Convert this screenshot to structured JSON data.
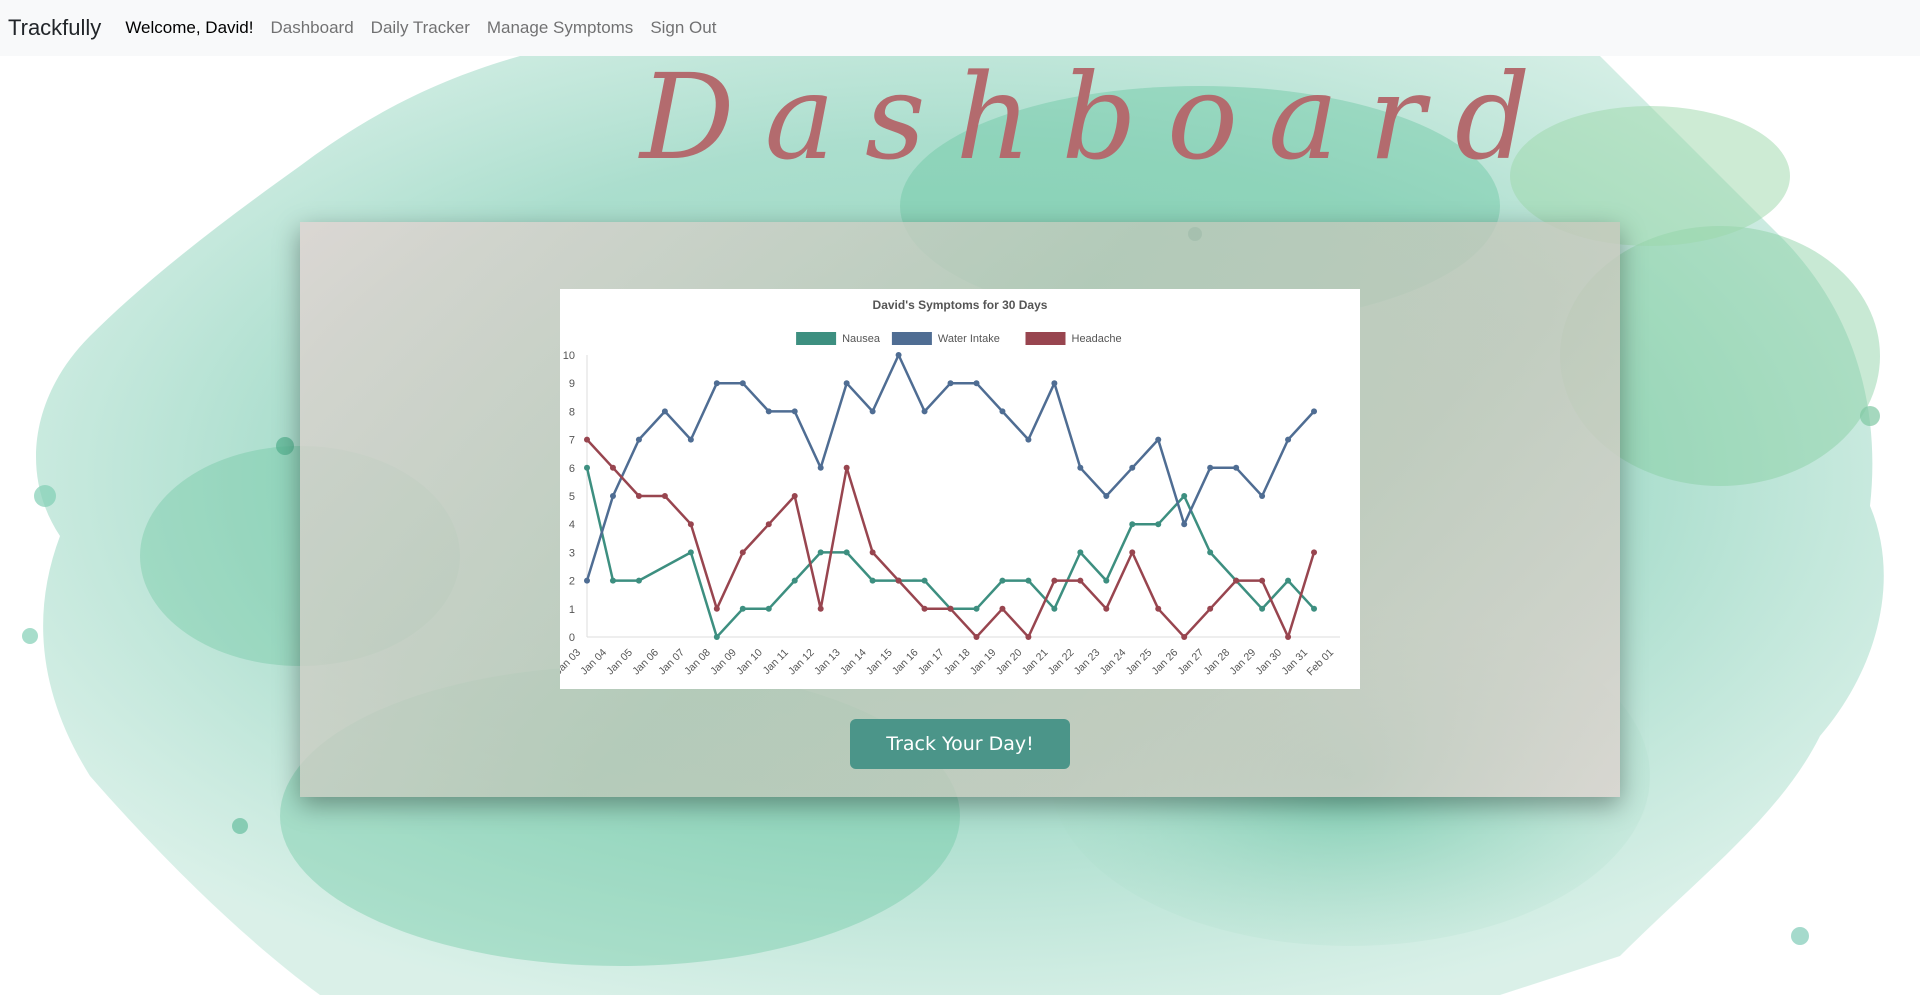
{
  "navbar": {
    "brand": "Trackfully",
    "welcome": "Welcome, David!",
    "links": [
      "Dashboard",
      "Daily Tracker",
      "Manage Symptoms",
      "Sign Out"
    ]
  },
  "page": {
    "title": "Dashboard",
    "button_label": "Track Your Day!"
  },
  "colors": {
    "nausea": "#3d8f80",
    "water": "#4f6d93",
    "headache": "#98454f",
    "title": "#b36b6e",
    "button": "#4b9589"
  },
  "chart_data": {
    "type": "line",
    "title": "David's Symptoms for 30 Days",
    "x": [
      "Jan 03",
      "Jan 04",
      "Jan 05",
      "Jan 06",
      "Jan 07",
      "Jan 08",
      "Jan 09",
      "Jan 10",
      "Jan 11",
      "Jan 12",
      "Jan 13",
      "Jan 14",
      "Jan 15",
      "Jan 16",
      "Jan 17",
      "Jan 18",
      "Jan 19",
      "Jan 20",
      "Jan 21",
      "Jan 22",
      "Jan 23",
      "Jan 24",
      "Jan 25",
      "Jan 26",
      "Jan 27",
      "Jan 28",
      "Jan 29",
      "Jan 30",
      "Jan 31",
      "Feb 01"
    ],
    "ylim": [
      0,
      10
    ],
    "yticks": [
      0,
      1,
      2,
      3,
      4,
      5,
      6,
      7,
      8,
      9,
      10
    ],
    "legend_position": "top",
    "series": [
      {
        "name": "Nausea",
        "color": "#3d8f80",
        "values": [
          6,
          2,
          2,
          null,
          3,
          0,
          1,
          1,
          2,
          3,
          3,
          2,
          2,
          2,
          1,
          1,
          2,
          2,
          1,
          3,
          2,
          4,
          4,
          5,
          3,
          2,
          1,
          2,
          1,
          null
        ]
      },
      {
        "name": "Water Intake",
        "color": "#4f6d93",
        "values": [
          2,
          5,
          7,
          8,
          7,
          9,
          9,
          8,
          8,
          6,
          9,
          8,
          10,
          8,
          9,
          9,
          8,
          7,
          9,
          6,
          5,
          6,
          7,
          4,
          6,
          6,
          5,
          7,
          8,
          null
        ]
      },
      {
        "name": "Headache",
        "color": "#98454f",
        "values": [
          7,
          6,
          5,
          5,
          4,
          1,
          3,
          4,
          5,
          1,
          6,
          3,
          2,
          1,
          1,
          0,
          1,
          0,
          2,
          2,
          1,
          3,
          1,
          0,
          1,
          2,
          2,
          0,
          3,
          null
        ]
      }
    ]
  }
}
